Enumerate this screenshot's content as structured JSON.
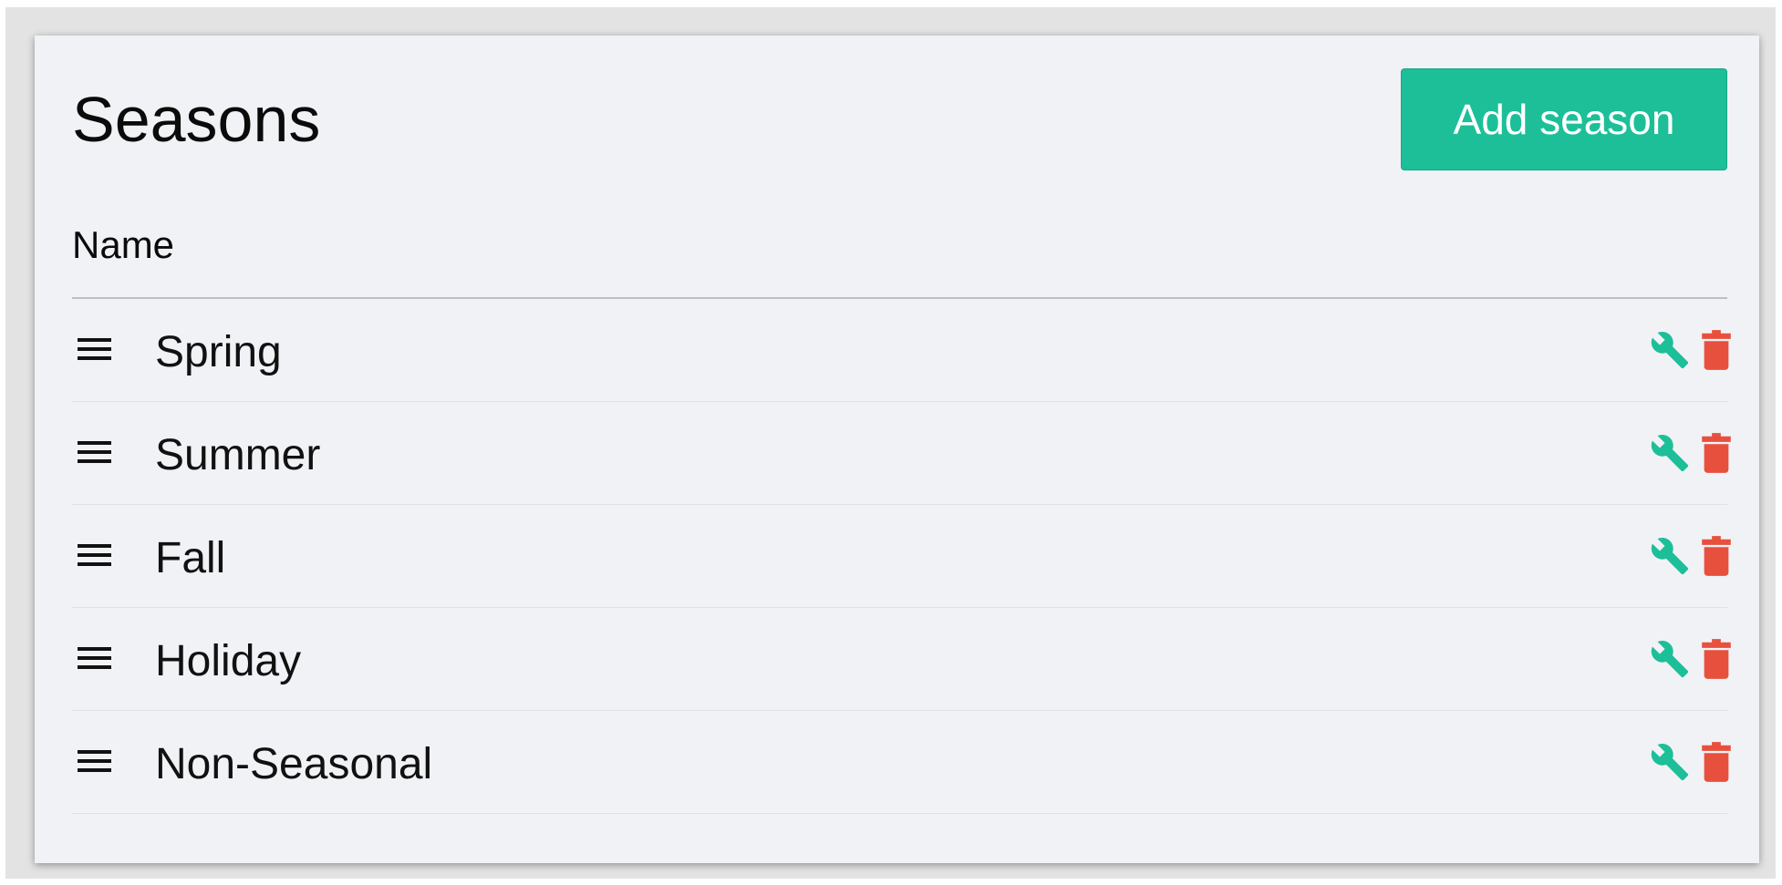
{
  "page": {
    "title": "Seasons",
    "add_button_label": "Add season",
    "column_header": "Name"
  },
  "seasons": [
    {
      "name": "Spring"
    },
    {
      "name": "Summer"
    },
    {
      "name": "Fall"
    },
    {
      "name": "Holiday"
    },
    {
      "name": "Non-Seasonal"
    }
  ],
  "icons": {
    "drag": "drag-handle-icon",
    "edit": "wrench-icon",
    "delete": "trash-icon"
  },
  "colors": {
    "accent": "#1dbf98",
    "danger": "#e8503e",
    "card_background": "#f1f2f6"
  }
}
